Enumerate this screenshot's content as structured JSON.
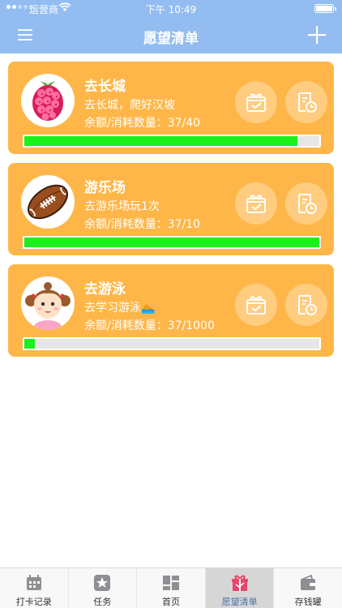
{
  "status_bar": {
    "carrier": "运营商",
    "time": "下午 10:49"
  },
  "nav": {
    "title": "愿望清单",
    "left_icon": "menu-icon",
    "right_icon": "plus-icon"
  },
  "wishes": [
    {
      "name": "去长城",
      "description": "去长城，爬好汉坡",
      "balance": "余额/消耗数量：37/40",
      "progress": 0.925,
      "avatar_icon": "raspberry-icon"
    },
    {
      "name": "游乐场",
      "description": "去游乐场玩1次",
      "balance": "余额/消耗数量：37/10",
      "progress": 1.0,
      "avatar_icon": "football-icon"
    },
    {
      "name": "去游泳",
      "description": "去学习游泳🏊",
      "balance": "余额/消耗数量：37/1000",
      "progress": 0.037,
      "avatar_icon": "girl-icon"
    }
  ],
  "tabs": [
    {
      "label": "打卡记录",
      "icon": "calendar-icon",
      "active": false
    },
    {
      "label": "任务",
      "icon": "star-icon",
      "active": false
    },
    {
      "label": "首页",
      "icon": "dashboard-icon",
      "active": false
    },
    {
      "label": "愿望清单",
      "icon": "gift-icon",
      "active": true
    },
    {
      "label": "存钱罐",
      "icon": "wallet-icon",
      "active": false
    }
  ],
  "colors": {
    "header": "#93bdf0",
    "card": "#ffb649",
    "progress_fill": "#1bf01b",
    "active_tab_label": "#4a73a8"
  }
}
